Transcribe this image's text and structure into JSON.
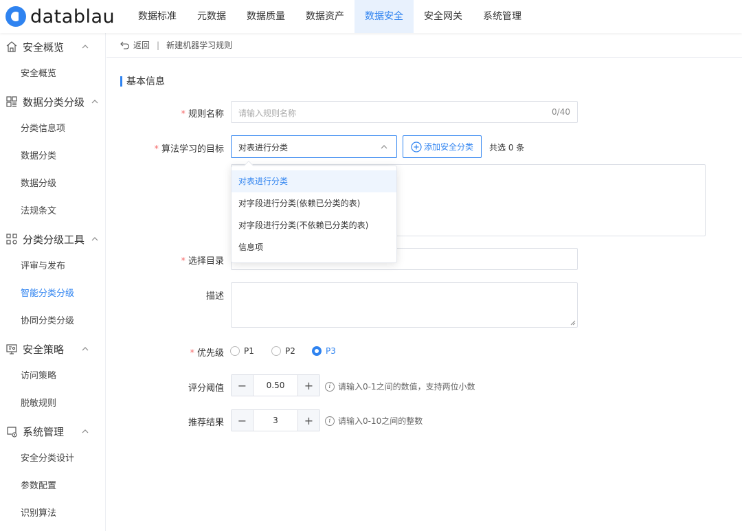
{
  "brand": {
    "logo_text": "datablau"
  },
  "nav": [
    {
      "label": "数据标准"
    },
    {
      "label": "元数据"
    },
    {
      "label": "数据质量"
    },
    {
      "label": "数据资产"
    },
    {
      "label": "数据安全",
      "active": true
    },
    {
      "label": "安全网关"
    },
    {
      "label": "系统管理"
    }
  ],
  "sidebar": {
    "groups": [
      {
        "label": "安全概览",
        "icon": "home-icon",
        "items": [
          "安全概览"
        ]
      },
      {
        "label": "数据分类分级",
        "icon": "grid-icon",
        "items": [
          "分类信息项",
          "数据分类",
          "数据分级",
          "法规条文"
        ]
      },
      {
        "label": "分类分级工具",
        "icon": "tools-icon",
        "items": [
          "评审与发布",
          "智能分类分级",
          "协同分类分级"
        ],
        "active_item": "智能分类分级"
      },
      {
        "label": "安全策略",
        "icon": "policy-icon",
        "items": [
          "访问策略",
          "脱敏规则"
        ]
      },
      {
        "label": "系统管理",
        "icon": "monitor-icon",
        "items": [
          "安全分类设计",
          "参数配置",
          "识别算法"
        ]
      }
    ]
  },
  "breadcrumb": {
    "back_label": "返回",
    "separator": "|",
    "current": "新建机器学习规则"
  },
  "section": {
    "title": "基本信息"
  },
  "form": {
    "rule_name": {
      "label": "规则名称",
      "placeholder": "请输入规则名称",
      "counter": "0/40"
    },
    "target": {
      "label": "算法学习的目标",
      "value": "对表进行分类",
      "add_button": "添加安全分类",
      "selected_count": "共选 0 条"
    },
    "directory": {
      "label": "选择目录"
    },
    "description": {
      "label": "描述"
    },
    "priority": {
      "label": "优先级",
      "options": [
        "P1",
        "P2",
        "P3"
      ],
      "selected": "P3"
    },
    "threshold": {
      "label": "评分阈值",
      "value": "0.50",
      "hint": "请输入0-1之间的数值，支持两位小数"
    },
    "recommend": {
      "label": "推荐结果",
      "value": "3",
      "hint": "请输入0-10之间的整数"
    }
  },
  "dropdown": {
    "options": [
      "对表进行分类",
      "对字段进行分类(依赖已分类的表)",
      "对字段进行分类(不依赖已分类的表)",
      "信息项"
    ],
    "selected": "对表进行分类"
  },
  "colors": {
    "accent": "#2f83f0",
    "required": "#f56c6c"
  }
}
